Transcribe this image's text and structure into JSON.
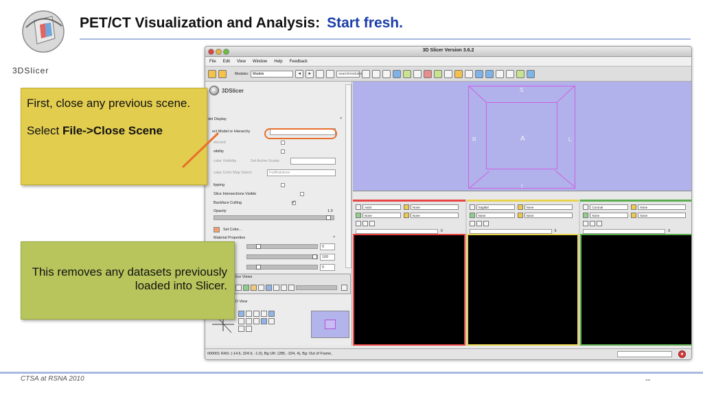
{
  "slide": {
    "title": "PET/CT Visualization and Analysis:",
    "title_accent": "Start fresh.",
    "logo_text": "3DSlicer",
    "footer": "CTSA at RSNA 2010",
    "page_marker": "--"
  },
  "callouts": {
    "first_line": "First, close any previous scene.",
    "select_prefix": "Select ",
    "select_bold": "File->Close Scene",
    "second": "This removes any datasets previously  loaded into Slicer."
  },
  "window": {
    "title": "3D Slicer Version 3.6.2",
    "menu": [
      "File",
      "Edit",
      "View",
      "Window",
      "Help",
      "Feedback"
    ],
    "toolbar": {
      "modules_label": "Modules:",
      "module_value": "Models",
      "search_placeholder": "searchmodules"
    },
    "brand": "3DSlicer",
    "model_display": {
      "header": "del Display",
      "close_glyph": "×",
      "select_label": "ect Model or Hierarchy",
      "visible_partial": "elected",
      "visibility": "sibility",
      "scalar_visibility": "calar Visibility",
      "set_active_scalar": "Set Active Scalar:",
      "color_map": "calar Color Map Select",
      "color_map_value": "FullRainbow",
      "clipping": "lipping",
      "slice_intersections": "Slice Intersections Visible",
      "backface": "Backface Culling",
      "opacity": "Opacity",
      "opacity_value": "1.0",
      "set_color": "Set Color...",
      "material": "Material Properties",
      "mat_values": [
        "0",
        "100",
        "0"
      ]
    },
    "slice_views_label": "lice Views",
    "view3d_label": "D View",
    "view3d_axes": {
      "S": "S",
      "R": "R",
      "A": "A",
      "L": "L",
      "I": "I"
    },
    "slices": [
      {
        "orientation": "Axial",
        "fg": "None",
        "bg": "None",
        "value": "0"
      },
      {
        "orientation": "Sagittal",
        "fg": "None",
        "bg": "None",
        "value": "0"
      },
      {
        "orientation": "Coronal",
        "fg": "None",
        "bg": "None",
        "value": "0"
      }
    ],
    "status": "000001 RAS: (-14.6, 324.9, -1.0), Bg IJK: (285, -324, 4), Bg: Out of Frame,"
  },
  "colors": {
    "title_accent": "#1a3ea8",
    "callout_yellow": "#e2cd4f",
    "callout_green": "#b7c55c",
    "view3d_bg": "#b1b2eb",
    "cube_edges": "#cf5fe0",
    "highlight": "#e8702a"
  }
}
